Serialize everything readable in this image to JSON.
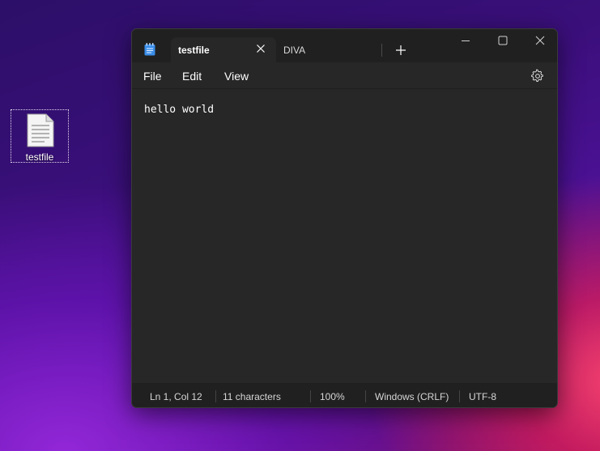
{
  "desktop": {
    "icon_label": "testfile"
  },
  "window": {
    "tabs": [
      {
        "label": "testfile",
        "active": true
      },
      {
        "label": "DIVA",
        "active": false
      }
    ],
    "new_tab_glyph": "+",
    "menu": {
      "file": "File",
      "edit": "Edit",
      "view": "View"
    },
    "editor": {
      "content": "hello world"
    },
    "status": {
      "position": "Ln 1, Col 12",
      "characters": "11 characters",
      "zoom": "100%",
      "line_ending": "Windows (CRLF)",
      "encoding": "UTF-8"
    },
    "icons": {
      "app": "notepad-icon",
      "tab_close": "close-icon",
      "new_tab": "plus-icon",
      "minimize": "minimize-icon",
      "maximize": "maximize-icon",
      "close": "close-icon",
      "settings": "gear-icon"
    },
    "colors": {
      "titlebar": "#202020",
      "editor_bg": "#272727",
      "text": "#ffffff",
      "app_icon_blue": "#3b8eea"
    }
  }
}
